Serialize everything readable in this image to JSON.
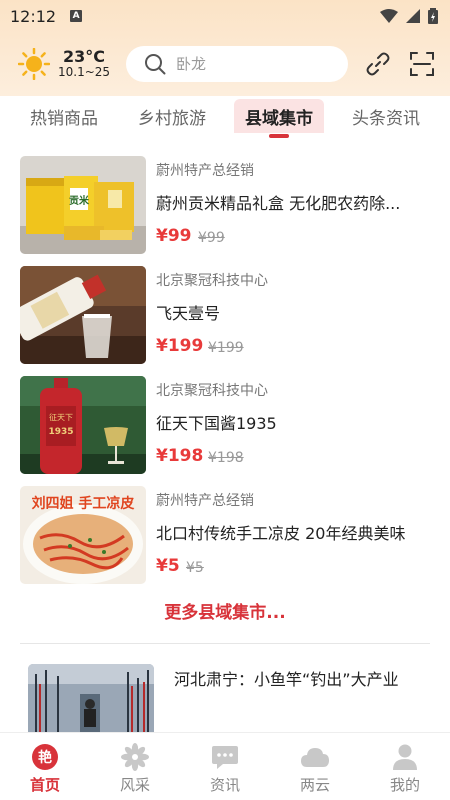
{
  "status_bar": {
    "time": "12:12",
    "badge": "A"
  },
  "weather": {
    "temperature": "23°C",
    "range": "10.1~25"
  },
  "search": {
    "placeholder": "卧龙"
  },
  "tabs": [
    {
      "label": "热销商品",
      "active": false
    },
    {
      "label": "乡村旅游",
      "active": false
    },
    {
      "label": "县域集市",
      "active": true
    },
    {
      "label": "头条资讯",
      "active": false
    }
  ],
  "products": [
    {
      "seller": "蔚州特产总经销",
      "name": "蔚州贡米精品礼盒 无化肥农药除...",
      "price": "¥99",
      "original_price": "¥99"
    },
    {
      "seller": "北京聚冠科技中心",
      "name": "飞天壹号",
      "price": "¥199",
      "original_price": "¥199"
    },
    {
      "seller": "北京聚冠科技中心",
      "name": "征天下国酱1935",
      "price": "¥198",
      "original_price": "¥198"
    },
    {
      "seller": "蔚州特产总经销",
      "name": "北口村传统手工凉皮 20年经典美味",
      "price": "¥5",
      "original_price": "¥5"
    }
  ],
  "more_link": "更多县域集市...",
  "news": [
    {
      "title": "河北肃宁：小鱼竿“钓出”大产业"
    }
  ],
  "product_image_text": {
    "rice_box": "贡米",
    "liquor_label": "征天下",
    "liquor_year": "1935",
    "noodle_calligraphy": "刘四姐 手工凉皮"
  },
  "bottom_nav": [
    {
      "label": "首页",
      "icon": "home-logo-icon",
      "glyph": "艳",
      "active": true
    },
    {
      "label": "风采",
      "icon": "flower-icon",
      "active": false
    },
    {
      "label": "资讯",
      "icon": "message-icon",
      "active": false
    },
    {
      "label": "两云",
      "icon": "cloud-icon",
      "active": false
    },
    {
      "label": "我的",
      "icon": "person-icon",
      "active": false
    }
  ],
  "colors": {
    "accent": "#d8333a",
    "price": "#e83a3a",
    "header_bg": "#fbe3c6",
    "active_tab_bg": "#fbe3e3",
    "sun": "#f5b21b"
  }
}
